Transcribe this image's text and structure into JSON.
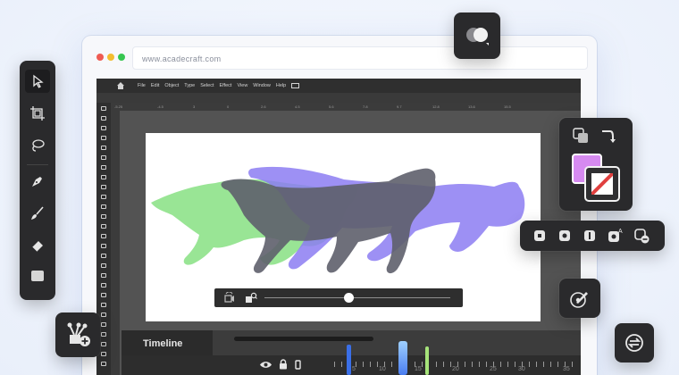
{
  "browser": {
    "url": "www.acadecraft.com"
  },
  "menu": [
    "File",
    "Edit",
    "Object",
    "Type",
    "Select",
    "Effect",
    "View",
    "Window",
    "Help"
  ],
  "ruler_top": [
    "-5.25",
    "-4.5",
    "3",
    "0",
    "2.6",
    "4.5",
    "5.6",
    "7.8",
    "9.7",
    "12.8",
    "13.6",
    "15.5"
  ],
  "timeline": {
    "label": "Timeline",
    "ticks": [
      "5",
      "10",
      "15",
      "20",
      "25",
      "30",
      "35"
    ],
    "scrubber_progress": 0.38
  },
  "player": {
    "progress": 0.45
  },
  "colors": {
    "accent": "#4a7df0",
    "fill_swatch": "#d68af0",
    "cat_green": "#8ee28a",
    "cat_gray": "#5e5f6b",
    "cat_purple": "#8c7cf2"
  },
  "icons": {
    "left_toolbar": [
      "select-arrow-icon",
      "artboard-crop-icon",
      "lasso-icon",
      "pen-icon",
      "brush-icon",
      "eraser-icon",
      "shape-rectangle-icon"
    ],
    "floating": [
      "shape-builder-icon",
      "arrange-icon",
      "swap-colors-icon",
      "add-anchor-icon",
      "color-picker-icon",
      "sync-icon"
    ]
  }
}
